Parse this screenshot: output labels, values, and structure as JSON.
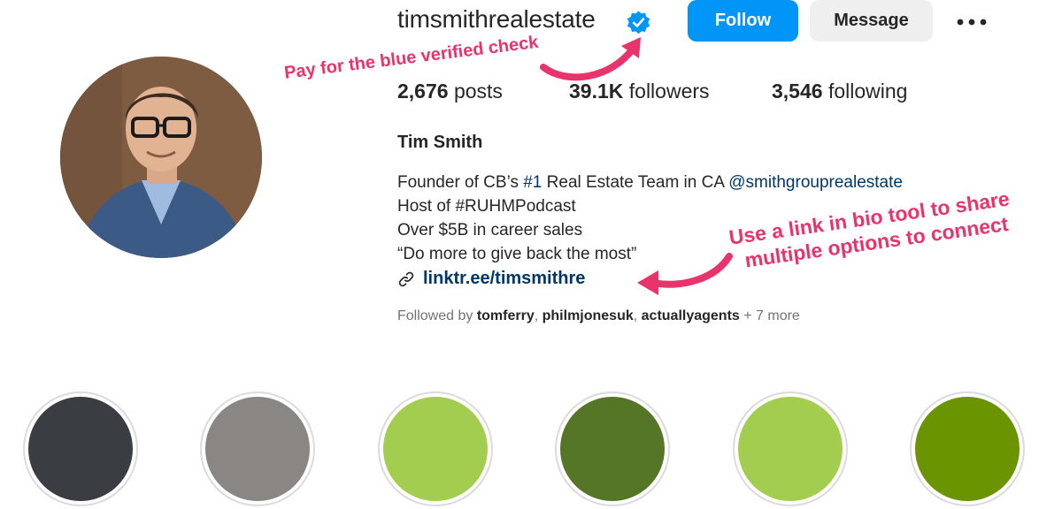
{
  "profile": {
    "username": "timsmithrealestate",
    "verified_icon": "verified-badge-icon",
    "follow_label": "Follow",
    "message_label": "Message",
    "more_icon": "more-options-icon"
  },
  "stats": {
    "posts_value": "2,676",
    "posts_label": "posts",
    "followers_value": "39.1K",
    "followers_label": "followers",
    "following_value": "3,546",
    "following_label": "following"
  },
  "bio": {
    "full_name": "Tim Smith",
    "line1_a": "Founder of CB’s ",
    "line1_hashtag": "#1",
    "line1_b": " Real Estate Team in CA ",
    "line1_mention": "@smithgrouprealestate",
    "line2": "Host of #RUHMPodcast",
    "line3": "Over $5B in career sales",
    "line4": "“Do more to give back the most”",
    "link_text": "linktr.ee/timsmithre",
    "link_icon": "link-icon"
  },
  "followed_by": {
    "prefix": "Followed by ",
    "user1": "tomferry",
    "sep1": ", ",
    "user2": "philmjonesuk",
    "sep2": ", ",
    "user3": "actuallyagents",
    "suffix": " + 7 more"
  },
  "annotations": {
    "verified_note": "Pay for the blue verified check",
    "link_note_line1": "Use a link in bio tool to share",
    "link_note_line2": "multiple options to connect"
  },
  "highlights": [
    {
      "color": "#3a3d41"
    },
    {
      "color": "#8a8683"
    },
    {
      "color": "#a3cd4e"
    },
    {
      "color": "#557626"
    },
    {
      "color": "#a3cd4e"
    },
    {
      "color": "#6a9400"
    }
  ],
  "colors": {
    "accent": "#0095f6",
    "annotation": "#e8336c",
    "link": "#00376b"
  }
}
